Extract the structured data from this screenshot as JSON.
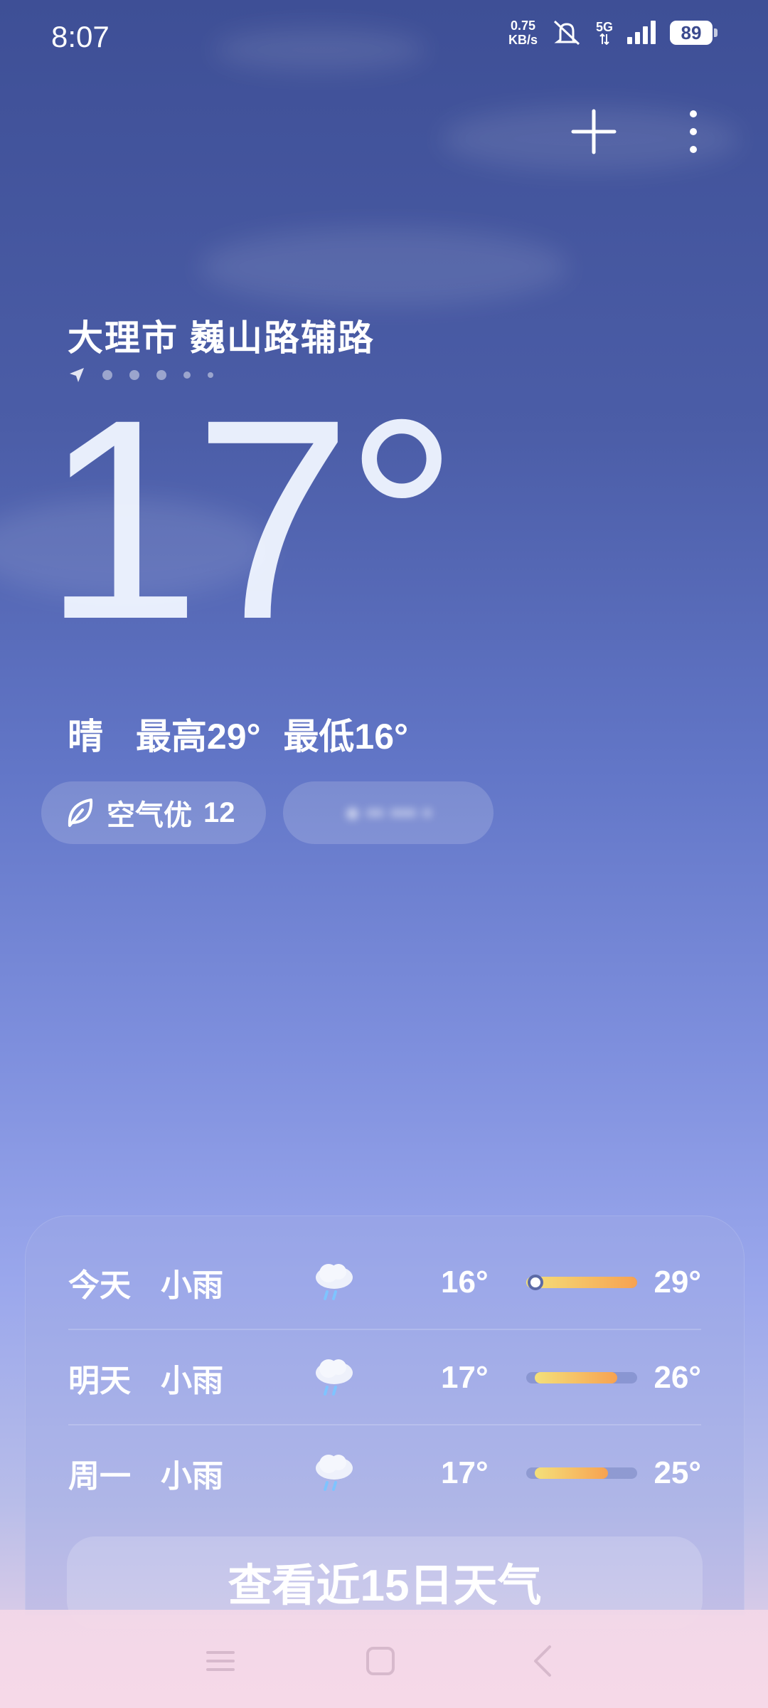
{
  "status_bar": {
    "time": "8:07",
    "net_speed_value": "0.75",
    "net_speed_unit": "KB/s",
    "network": "5G",
    "battery": "89"
  },
  "location": {
    "name": "大理市 巍山路辅路"
  },
  "current": {
    "temperature": "17°",
    "condition": "晴",
    "high": "最高29°",
    "low": "最低16°"
  },
  "air_quality": {
    "label": "空气优",
    "value": "12"
  },
  "forecast": [
    {
      "day": "今天",
      "condition": "小雨",
      "icon": "light-rain-icon",
      "low": "16°",
      "high": "29°",
      "bar_start": 0.0,
      "bar_end": 1.0
    },
    {
      "day": "明天",
      "condition": "小雨",
      "icon": "light-rain-icon",
      "low": "17°",
      "high": "26°",
      "bar_start": 0.08,
      "bar_end": 0.82
    },
    {
      "day": "周一",
      "condition": "小雨",
      "icon": "light-rain-icon",
      "low": "17°",
      "high": "25°",
      "bar_start": 0.08,
      "bar_end": 0.74
    }
  ],
  "more_button": "查看近15日天气",
  "colors": {
    "bar_start": "#f4e07a",
    "bar_end": "#f7a251"
  }
}
